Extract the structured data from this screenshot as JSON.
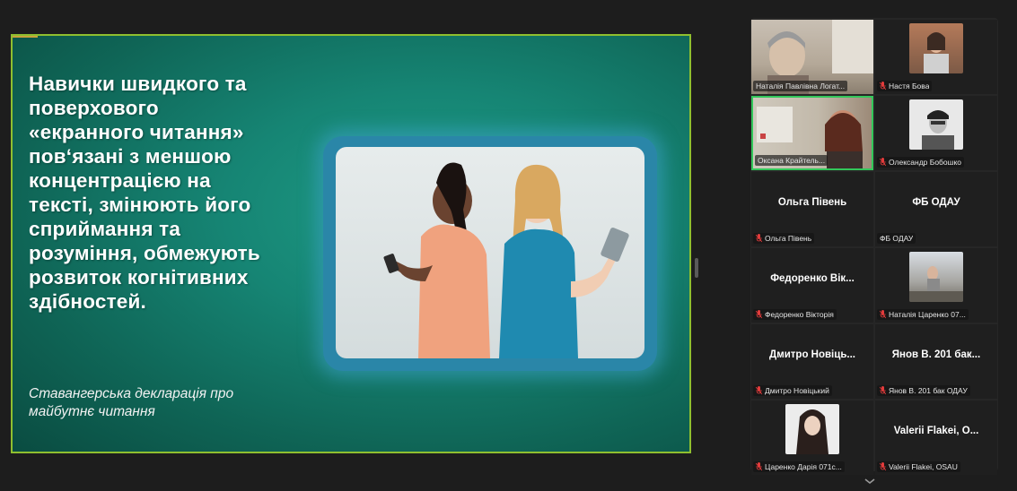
{
  "slide": {
    "heading": "Навички швидкого та\nповерхового\n«екранного читання»\nпов‘язані з меншою\nконцентрацією на\nтексті, змінюють його\nсприймання та\nрозуміння, обмежують\nрозвиток когнітивних\nздібностей.",
    "quote": "Ставангерська декларація про\nмайбутнє читання",
    "background_color": "#168574",
    "border_color": "#8fbf2f"
  },
  "participants": [
    {
      "caption": "Наталія Павлівна Логат...",
      "has_video": true,
      "muted": false
    },
    {
      "caption": "Настя Бова",
      "has_video": true,
      "muted": true
    },
    {
      "caption": "Оксана Крайтель...",
      "has_video": true,
      "muted": false,
      "active_speaker": true
    },
    {
      "caption": "Олександр Бобошко",
      "has_video": true,
      "muted": true
    },
    {
      "display_name": "Ольга Півень",
      "caption": "Ольга Півень",
      "has_video": false,
      "muted": true
    },
    {
      "display_name": "ФБ ОДАУ",
      "caption": "ФБ ОДАУ",
      "has_video": false,
      "muted": false
    },
    {
      "display_name": "Федоренко  Вік...",
      "caption": "Федоренко Вікторія",
      "has_video": false,
      "muted": true
    },
    {
      "caption": "Наталія Царенко 07...",
      "has_video": true,
      "muted": true
    },
    {
      "display_name": "Дмитро  Новіць...",
      "caption": "Дмитро Новіцький",
      "has_video": false,
      "muted": true
    },
    {
      "display_name": "Янов В. 201 бак...",
      "caption": "Янов В. 201 бак ОДАУ",
      "has_video": false,
      "muted": true
    },
    {
      "caption": "Царенко Дарія 071с...",
      "has_video": true,
      "muted": true
    },
    {
      "display_name": "Valerii  Flakei, O...",
      "caption": "Valerii Flakei, OSAU",
      "has_video": false,
      "muted": true
    }
  ],
  "colors": {
    "active_speaker_border": "#33c75a",
    "muted_mic": "#e23b3b"
  },
  "icons": {
    "muted_mic": "mic-muted-icon",
    "gallery_more": "chevron-down-icon"
  }
}
